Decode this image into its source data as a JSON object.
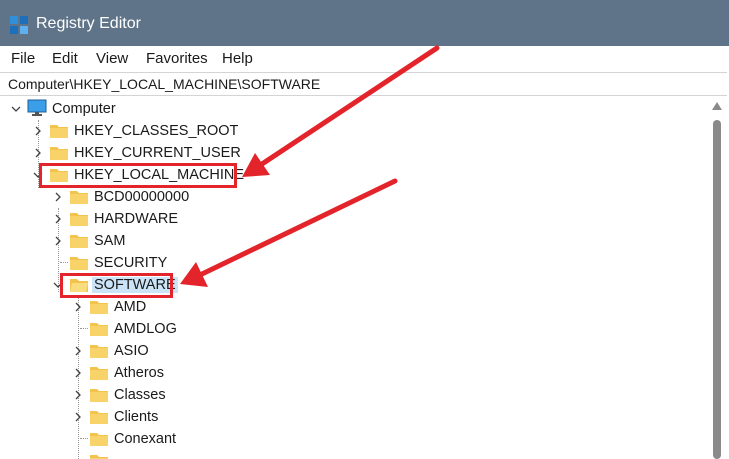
{
  "window": {
    "title": "Registry Editor",
    "icon": "registry-editor-icon"
  },
  "menu": [
    "File",
    "Edit",
    "View",
    "Favorites",
    "Help"
  ],
  "address": {
    "path": "Computer\\HKEY_LOCAL_MACHINE\\SOFTWARE"
  },
  "tree": {
    "root": {
      "label": "Computer",
      "icon": "computer-icon",
      "expanded": true
    },
    "hives": [
      {
        "label": "HKEY_CLASSES_ROOT",
        "expanded": false
      },
      {
        "label": "HKEY_CURRENT_USER",
        "expanded": false
      },
      {
        "label": "HKEY_LOCAL_MACHINE",
        "expanded": true,
        "highlighted": true
      }
    ],
    "hklm_children": [
      {
        "label": "BCD00000000",
        "has_children": true
      },
      {
        "label": "HARDWARE",
        "has_children": true
      },
      {
        "label": "SAM",
        "has_children": true
      },
      {
        "label": "SECURITY",
        "has_children": false
      },
      {
        "label": "SOFTWARE",
        "has_children": true,
        "expanded": true,
        "selected": true,
        "highlighted": true
      }
    ],
    "software_children": [
      {
        "label": "AMD",
        "has_children": true
      },
      {
        "label": "AMDLOG",
        "has_children": false
      },
      {
        "label": "ASIO",
        "has_children": true
      },
      {
        "label": "Atheros",
        "has_children": true
      },
      {
        "label": "Classes",
        "has_children": true
      },
      {
        "label": "Clients",
        "has_children": true
      },
      {
        "label": "Conexant",
        "has_children": false
      }
    ]
  },
  "annotations": {
    "color": "#e3242b",
    "arrow_count": 2
  },
  "colors": {
    "titlebar": "#5f7488",
    "folder": "#f2c44d",
    "selection": "#cce4f7",
    "annotation": "#e3242b"
  }
}
